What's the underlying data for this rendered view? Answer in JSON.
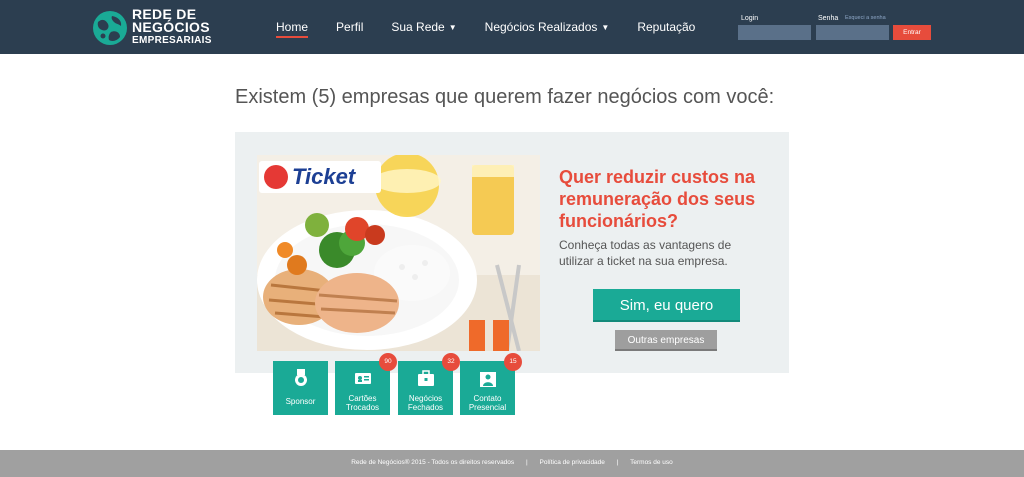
{
  "brand": {
    "line1": "REDE DE",
    "line2": "NEGÓCIOS",
    "line3": "EMPRESARIAIS"
  },
  "nav": {
    "items": [
      {
        "label": "Home",
        "active": true
      },
      {
        "label": "Perfil"
      },
      {
        "label": "Sua Rede",
        "dropdown": true
      },
      {
        "label": "Negócios Realizados",
        "dropdown": true
      },
      {
        "label": "Reputação"
      }
    ]
  },
  "login": {
    "login_label": "Login",
    "password_label": "Senha",
    "forgot_label": "Esqueci a senha",
    "submit_label": "Entrar"
  },
  "main": {
    "headline": "Existem (5) empresas que querem fazer negócios com você:",
    "ad": {
      "brand": "Ticket",
      "title": "Quer reduzir custos na remuneração dos seus funcionários?",
      "description": "Conheça todas as vantagens de utilizar a ticket na sua empresa.",
      "primary_button": "Sim, eu quero",
      "secondary_button": "Outras empresas"
    },
    "tiles": [
      {
        "label": "Sponsor",
        "icon": "medal-icon"
      },
      {
        "label_1": "Cartões",
        "label_2": "Trocados",
        "badge": "90",
        "icon": "business-card-icon"
      },
      {
        "label_1": "Negócios",
        "label_2": "Fechados",
        "badge": "32",
        "icon": "briefcase-icon"
      },
      {
        "label_1": "Contato",
        "label_2": "Presencial",
        "badge": "15",
        "icon": "person-icon"
      }
    ]
  },
  "footer": {
    "copyright": "Rede de Negócios® 2015 - Todos os direitos reservados",
    "privacy": "Política de privacidade",
    "terms": "Termos de uso",
    "separator": "|"
  },
  "colors": {
    "header_bg": "#2c3e50",
    "accent_red": "#e74c3c",
    "teal": "#1aaa96",
    "ad_bg": "#ecf0f1",
    "footer_bg": "#a0a0a0"
  }
}
